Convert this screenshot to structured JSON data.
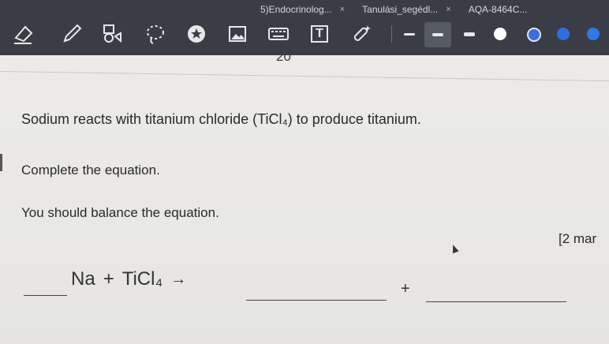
{
  "browser": {
    "tabs": [
      {
        "label": "5)Endocrinolog...",
        "close": "×"
      },
      {
        "label": "Tanulási_segédl...",
        "close": "×"
      },
      {
        "label": "AQA-8464C..."
      }
    ]
  },
  "toolbar": {
    "tools": [
      {
        "name": "eraser-icon"
      },
      {
        "name": "pen-icon"
      },
      {
        "name": "shapes-icon"
      },
      {
        "name": "lasso-icon"
      },
      {
        "name": "star-sticker-icon"
      },
      {
        "name": "image-icon"
      },
      {
        "name": "keyboard-icon"
      },
      {
        "name": "text-box-icon",
        "glyph": "T"
      },
      {
        "name": "magic-pen-icon"
      }
    ],
    "colors": [
      "#ffffff",
      "#3d6be0",
      "#2f6fe0",
      "#2f79e6"
    ]
  },
  "page": {
    "number": "20",
    "question_intro": "Sodium reacts with titanium chloride (TiCl₄) to produce titanium.",
    "instruction1": "Complete the equation.",
    "instruction2": "You should balance the equation.",
    "marks": "[2 mar",
    "equation": {
      "reactant1": "Na",
      "plus1": "+",
      "reactant2": "TiCl₄",
      "arrow": "→",
      "plus2": "+"
    }
  }
}
